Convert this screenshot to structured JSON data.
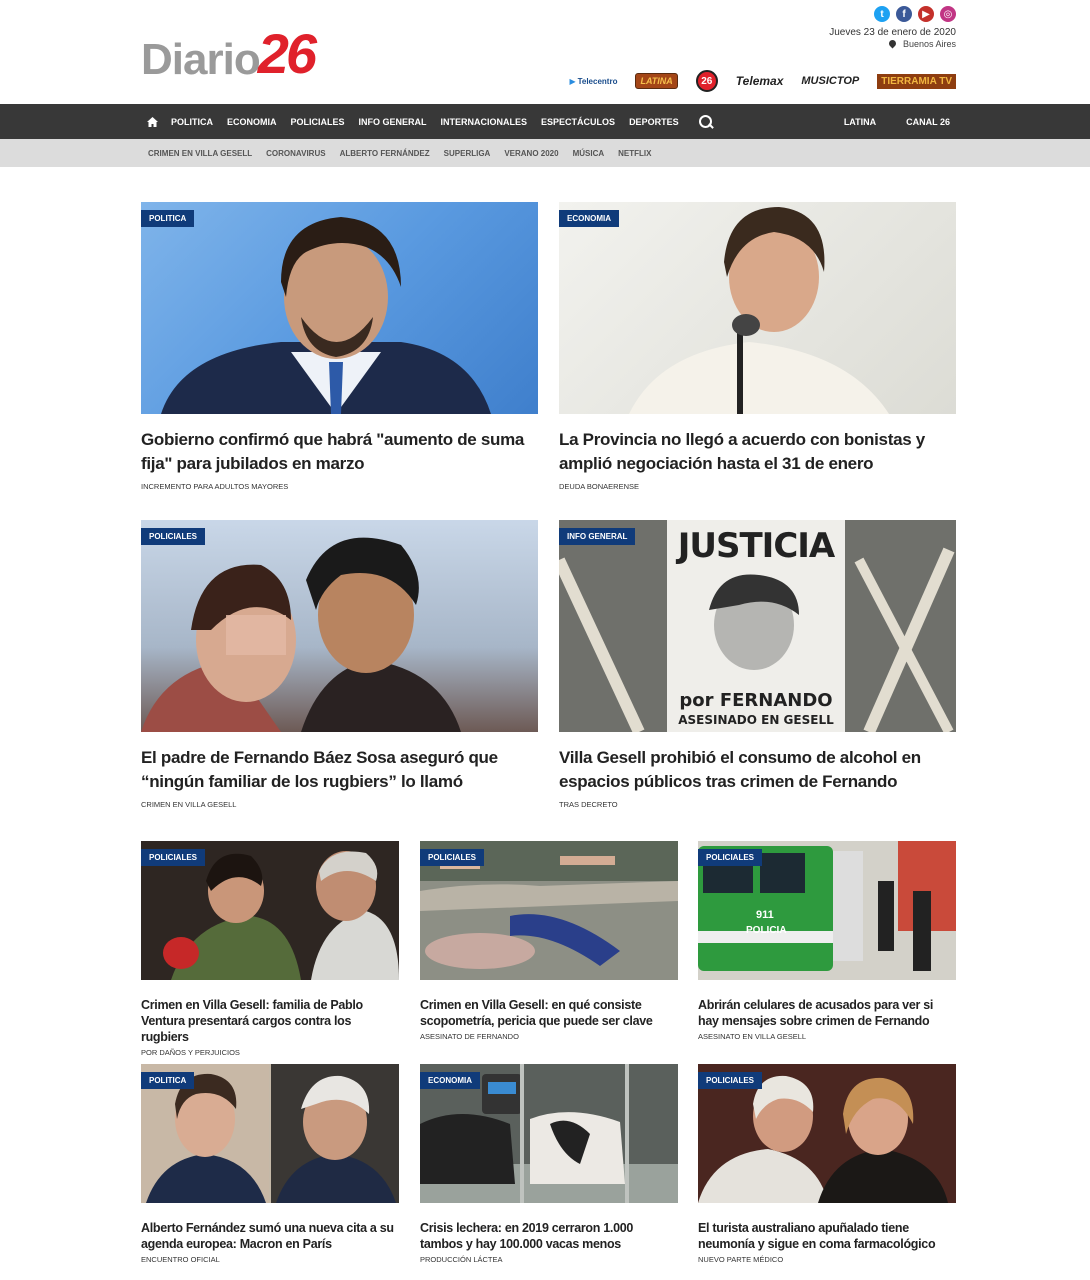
{
  "site": {
    "logo_text": "Diario",
    "logo_number": "26",
    "date": "Jueves 23 de enero de 2020",
    "city": "Buenos Aires",
    "social": [
      "twitter-icon",
      "facebook-icon",
      "youtube-icon",
      "instagram-icon"
    ],
    "channels": [
      "Telecentro",
      "LATINA",
      "26",
      "Telemax",
      "MUSICTOP",
      "TIERRAMIA TV"
    ],
    "colors": {
      "accent_red": "#e0212b",
      "tag_blue": "#103b7a",
      "nav_bg": "#383838",
      "subnav_bg": "#dcdcdc"
    }
  },
  "nav": {
    "items": [
      "POLITICA",
      "ECONOMIA",
      "POLICIALES",
      "INFO GENERAL",
      "INTERNACIONALES",
      "ESPECTÁCULOS",
      "DEPORTES"
    ],
    "right": [
      "LATINA",
      "CANAL 26"
    ]
  },
  "subnav": {
    "items": [
      "CRIMEN EN VILLA GESELL",
      "CORONAVIRUS",
      "ALBERTO FERNÁNDEZ",
      "SUPERLIGA",
      "VERANO 2020",
      "MÚSICA",
      "NETFLIX"
    ]
  },
  "articles": [
    {
      "tag": "POLITICA",
      "headline": "Gobierno confirmó que habrá \"aumento de suma fija\" para jubilados en marzo",
      "kicker": "INCREMENTO PARA ADULTOS MAYORES"
    },
    {
      "tag": "ECONOMIA",
      "headline": "La Provincia no llegó a acuerdo con bonistas y amplió negociación hasta el 31 de enero",
      "kicker": "DEUDA BONAERENSE"
    },
    {
      "tag": "POLICIALES",
      "headline": "El padre de Fernando Báez Sosa aseguró que “ningún familiar de los rugbiers” lo llamó",
      "kicker": "CRIMEN EN VILLA GESELL"
    },
    {
      "tag": "INFO GENERAL",
      "headline": "Villa Gesell prohibió el consumo de alcohol en espacios públicos tras crimen de Fernando",
      "kicker": "TRAS DECRETO",
      "sign_title": "JUSTICIA",
      "sign_line1": "por FERNANDO",
      "sign_line2": "ASESINADO EN GESELL"
    },
    {
      "tag": "POLICIALES",
      "headline": "Crimen en Villa Gesell: familia de Pablo Ventura presentará cargos contra los rugbiers",
      "kicker": "POR DAÑOS Y PERJUICIOS"
    },
    {
      "tag": "POLICIALES",
      "headline": "Crimen en Villa Gesell: en qué consiste scopometría, pericia que puede ser clave",
      "kicker": "ASESINATO DE FERNANDO"
    },
    {
      "tag": "POLICIALES",
      "headline": "Abrirán celulares de acusados para ver si hay mensajes sobre crimen de Fernando",
      "kicker": "ASESINATO EN VILLA GESELL",
      "van_text": "POLICIA",
      "van_num": "911"
    },
    {
      "tag": "POLITICA",
      "headline": "Alberto Fernández sumó una nueva cita a su agenda europea: Macron en París",
      "kicker": "ENCUENTRO OFICIAL"
    },
    {
      "tag": "ECONOMIA",
      "headline": "Crisis lechera: en 2019 cerraron 1.000 tambos y hay 100.000 vacas menos",
      "kicker": "PRODUCCIÓN LÁCTEA"
    },
    {
      "tag": "POLICIALES",
      "headline": "El turista australiano apuñalado tiene neumonía y sigue en coma farmacológico",
      "kicker": "NUEVO PARTE MÉDICO"
    }
  ]
}
